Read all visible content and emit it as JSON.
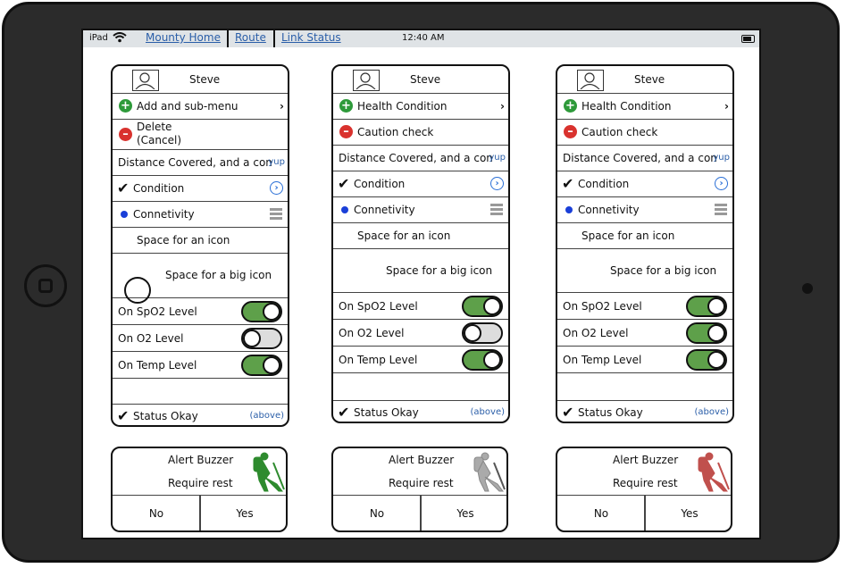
{
  "statusbar": {
    "device": "iPad",
    "nav": [
      "Mounty Home",
      "Route",
      "Link Status"
    ],
    "time": "12:40 AM"
  },
  "cards": [
    {
      "name": "Steve",
      "menu1": "Add and sub-menu",
      "menu2_line1": "Delete",
      "menu2_line2": "(Cancel)",
      "distance": "Distance Covered, and a conversation",
      "distance_tag": "yup",
      "condition": "Condition",
      "connectivity": "Connetivity",
      "space_icon": "Space for an icon",
      "space_big_icon": "Space for a big icon",
      "spo2": "On SpO2 Level",
      "spo2_on": true,
      "o2": "On  O2 Level",
      "o2_on": false,
      "temp": "On Temp  Level",
      "temp_on": true,
      "status": "Status Okay",
      "status_tag": "(above)"
    },
    {
      "name": "Steve",
      "menu1": "Health Condition",
      "menu2": "Caution check",
      "distance": "Distance Covered, and a conversation",
      "distance_tag": "yup",
      "condition": "Condition",
      "connectivity": "Connetivity",
      "space_icon": "Space for an icon",
      "space_big_icon": "Space for a big icon",
      "spo2": "On SpO2 Level",
      "spo2_on": true,
      "o2": "On  O2 Level",
      "o2_on": false,
      "temp": "On Temp  Level",
      "temp_on": true,
      "status": "Status Okay",
      "status_tag": "(above)"
    },
    {
      "name": "Steve",
      "menu1": "Health Condition",
      "menu2": "Caution check",
      "distance": "Distance Covered, and a conversation",
      "distance_tag": "yup",
      "condition": "Condition",
      "connectivity": "Connetivity",
      "space_icon": "Space for an icon",
      "space_big_icon": "Space for a big icon",
      "spo2": "On SpO2 Level",
      "spo2_on": true,
      "o2": "On  O2 Level",
      "o2_on": true,
      "temp": "On Temp  Level",
      "temp_on": true,
      "status": "Status Okay",
      "status_tag": "(above)"
    }
  ],
  "alerts": [
    {
      "title": "Alert Buzzer",
      "message": "Require rest",
      "no": "No",
      "yes": "Yes",
      "icon_color": "#2e8b2e"
    },
    {
      "title": "Alert Buzzer",
      "message": "Require rest",
      "no": "No",
      "yes": "Yes",
      "icon_color": "#aaaaaa"
    },
    {
      "title": "Alert Buzzer",
      "message": "Require rest",
      "no": "No",
      "yes": "Yes",
      "icon_color": "#c0504d"
    }
  ],
  "colors": {
    "toggle_on": "#5ea04a",
    "toggle_off": "#dddddd",
    "link": "#2a5ea8",
    "add_icon": "#2e9a3a",
    "delete_icon": "#d9322e"
  }
}
